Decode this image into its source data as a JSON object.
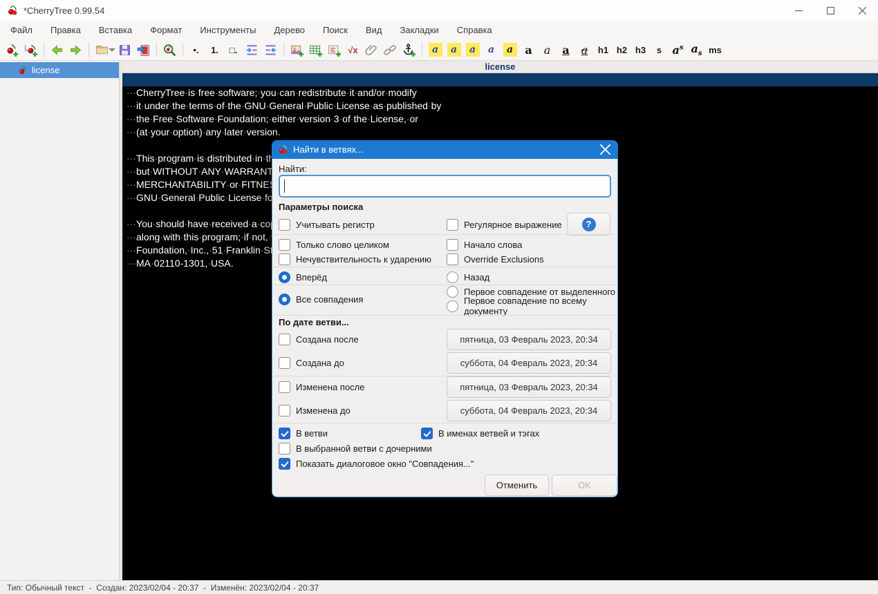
{
  "titlebar": {
    "title": "*CherryTree 0.99.54"
  },
  "menubar": {
    "items": [
      "Файл",
      "Правка",
      "Вставка",
      "Формат",
      "Инструменты",
      "Дерево",
      "Поиск",
      "Вид",
      "Закладки",
      "Справка"
    ]
  },
  "toolbar": {
    "bullet_list_glyph": "•.",
    "numbered_list_glyph": "1.",
    "todo_list_glyph": "□.",
    "formula_glyph": "√x",
    "color_a_glyph": "a",
    "bold_glyph": "a",
    "italic_glyph": "a",
    "underline_glyph": "a",
    "strikethrough_glyph": "a",
    "h1_glyph": "h1",
    "h2_glyph": "h2",
    "h3_glyph": "h3",
    "small_glyph": "s",
    "sup_base_glyph": "a",
    "sup_exp_glyph": "s",
    "sub_base_glyph": "a",
    "sub_sub_glyph": "s",
    "mono_glyph": "ms"
  },
  "sidebar": {
    "selected_node": "license"
  },
  "editor": {
    "title": "license",
    "lines": [
      "",
      "   CherryTree is free software; you can redistribute it and/or modify",
      "   it under the terms of the GNU General Public License as published by",
      "   the Free Software Foundation; either version 3 of the License, or",
      "   (at your option) any later version.",
      "",
      "   This program is distributed in the hope that it will be useful,",
      "   but WITHOUT ANY WARRANTY; without even the implied warranty of",
      "   MERCHANTABILITY or FITNESS FOR A PARTICULAR PURPOSE.  See the",
      "   GNU General Public License for more details.",
      "",
      "   You should have received a copy of the GNU General Public License",
      "   along with this program; if not, write to the Free Software",
      "   Foundation, Inc., 51 Franklin Street, Fifth Floor, Boston,",
      "   MA 02110-1301, USA."
    ]
  },
  "statusbar": {
    "text": "Тип: Обычный текст  -  Создан: 2023/02/04 - 20:37  -  Изменён: 2023/02/04 - 20:37"
  },
  "dialog": {
    "title": "Найти в ветвях...",
    "find_label": "Найти:",
    "find_value": "",
    "params_header": "Параметры поиска",
    "help_button": "?",
    "options": {
      "match_case": {
        "label": "Учитывать регистр",
        "checked": false
      },
      "regexp": {
        "label": "Регулярное выражение",
        "checked": false
      },
      "whole_word": {
        "label": "Только слово целиком",
        "checked": false
      },
      "start_word": {
        "label": "Начало слова",
        "checked": false
      },
      "accent_insensitive": {
        "label": "Нечувствительность к ударению",
        "checked": false
      },
      "override_exclusions": {
        "label": "Override Exclusions",
        "checked": false
      },
      "forward": {
        "label": "Вперёд",
        "selected": true
      },
      "backward": {
        "label": "Назад",
        "selected": false
      },
      "all_matches": {
        "label": "Все совпадения",
        "selected": true
      },
      "first_from_selection": {
        "label": "Первое совпадение от выделенного",
        "selected": false
      },
      "first_in_document": {
        "label": "Первое совпадение по всему документу",
        "selected": false
      }
    },
    "date_header": "По дате ветви...",
    "date_filters": {
      "created_after": {
        "label": "Создана после",
        "checked": false,
        "value": "пятница, 03 Февраль 2023, 20:34"
      },
      "created_before": {
        "label": "Создана до",
        "checked": false,
        "value": "суббота, 04 Февраль 2023, 20:34"
      },
      "modified_after": {
        "label": "Изменена после",
        "checked": false,
        "value": "пятница, 03 Февраль 2023, 20:34"
      },
      "modified_before": {
        "label": "Изменена до",
        "checked": false,
        "value": "суббота, 04 Февраль 2023, 20:34"
      }
    },
    "scope": {
      "in_node": {
        "label": "В ветви",
        "checked": true
      },
      "in_node_names_tags": {
        "label": "В именах ветвей и тэгах",
        "checked": true
      },
      "in_selected_with_children": {
        "label": "В выбранной ветви с дочерними",
        "checked": false
      },
      "show_matches_dialog": {
        "label": "Показать диалоговое окно \"Совпадения...\"",
        "checked": true
      }
    },
    "cancel_button": "Отменить",
    "ok_button": "OK",
    "ok_enabled": false
  },
  "colors": {
    "dialog_titlebar": "#1e79d2",
    "tree_selection": "#5591d5",
    "current_line_highlight": "#0d3a64",
    "editor_background": "#010101",
    "checkbox_checked": "#2569cf"
  }
}
